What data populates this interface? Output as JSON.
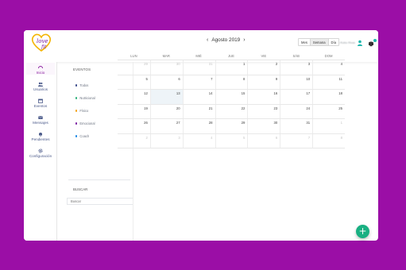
{
  "brand": {
    "logo_text_1": "love",
    "logo_text_2": "fit",
    "logo_colors": [
      "#7b1fa2",
      "#f4b400"
    ]
  },
  "header": {
    "username": "Alexandra Rubio Rivas",
    "notification_count": ""
  },
  "nav": {
    "items": [
      {
        "label": "Inicio",
        "icon": "half-circle-icon",
        "active": true
      },
      {
        "label": "Usuarios",
        "icon": "users-icon"
      },
      {
        "label": "Eventos",
        "icon": "calendar-icon"
      },
      {
        "label": "Mensajes",
        "icon": "envelope-icon"
      },
      {
        "label": "Pendientes",
        "icon": "bell-icon"
      },
      {
        "label": "Configuración",
        "icon": "gear-icon"
      }
    ]
  },
  "filters": {
    "title": "EVENTOS",
    "items": [
      {
        "label": "Todos",
        "color": "#3b4a8a"
      },
      {
        "label": "Nutricional",
        "color": "#2eb27a"
      },
      {
        "label": "Físico",
        "color": "#f4a31c"
      },
      {
        "label": "Emocional",
        "color": "#7b1fa2"
      },
      {
        "label": "Coach",
        "color": "#1e88e5"
      }
    ],
    "search_title": "BUSCAR",
    "search_placeholder": "Buscar"
  },
  "calendar": {
    "month_label": "Agosto 2019",
    "prev": "‹",
    "next": "›",
    "views": [
      "Mes",
      "Semana",
      "Día"
    ],
    "active_view": "Mes",
    "weekdays": [
      "LUN",
      "MAR",
      "MIÉ",
      "JUE",
      "VIE",
      "SÁB",
      "DOM"
    ],
    "weeks": [
      [
        "29",
        "30",
        "31",
        "1",
        "2",
        "3",
        "4"
      ],
      [
        "5",
        "6",
        "7",
        "8",
        "9",
        "10",
        "11"
      ],
      [
        "12",
        "13",
        "14",
        "15",
        "16",
        "17",
        "18"
      ],
      [
        "19",
        "20",
        "21",
        "22",
        "23",
        "24",
        "25"
      ],
      [
        "26",
        "27",
        "28",
        "29",
        "30",
        "31",
        "1"
      ],
      [
        "2",
        "3",
        "4",
        "5",
        "6",
        "7",
        "8"
      ]
    ]
  },
  "fab": {
    "label": "+"
  }
}
